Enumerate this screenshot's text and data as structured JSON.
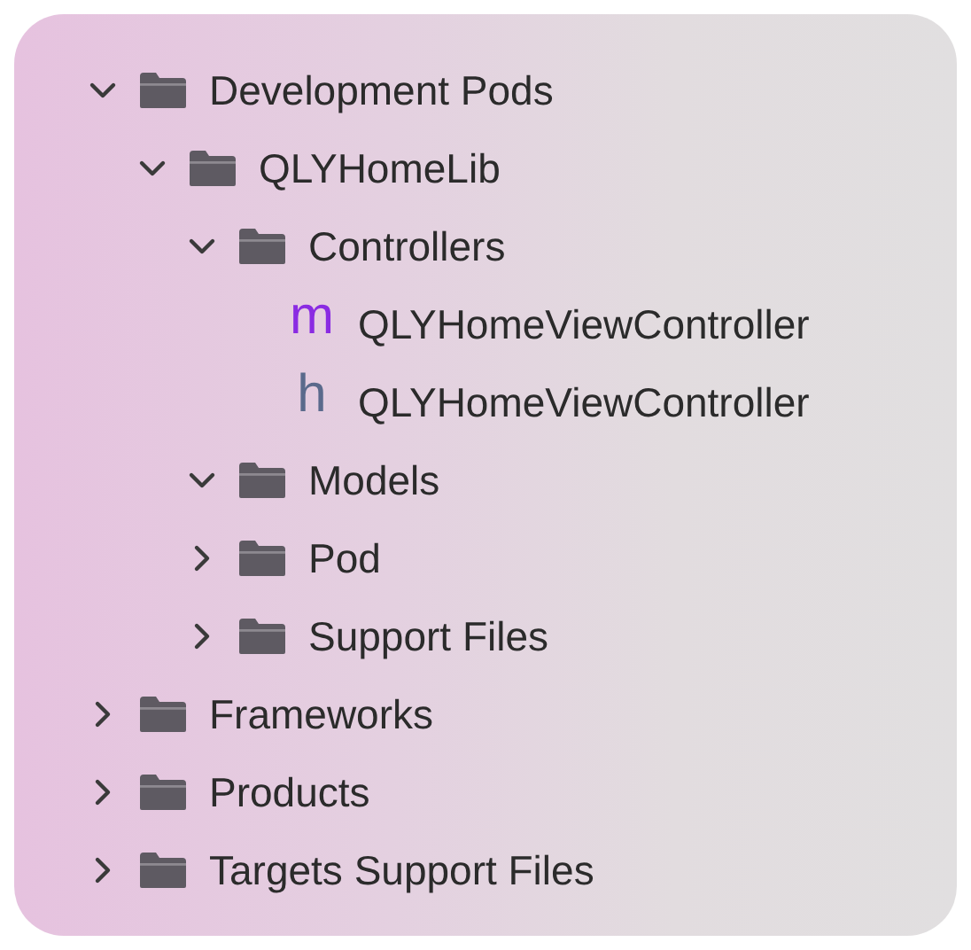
{
  "tree": [
    {
      "kind": "folder",
      "label": "Development Pods",
      "expanded": true,
      "children": [
        {
          "kind": "folder",
          "label": "QLYHomeLib",
          "expanded": true,
          "children": [
            {
              "kind": "folder",
              "label": "Controllers",
              "expanded": true,
              "children": [
                {
                  "kind": "file",
                  "badge": "m",
                  "color": "#8a2be2",
                  "label": "QLYHomeViewController"
                },
                {
                  "kind": "file",
                  "badge": "h",
                  "color": "#5a6a8c",
                  "label": "QLYHomeViewController"
                }
              ]
            },
            {
              "kind": "folder",
              "label": "Models",
              "expanded": true
            },
            {
              "kind": "folder",
              "label": "Pod",
              "expanded": false
            },
            {
              "kind": "folder",
              "label": "Support Files",
              "expanded": false
            }
          ]
        }
      ]
    },
    {
      "kind": "folder",
      "label": "Frameworks",
      "expanded": false
    },
    {
      "kind": "folder",
      "label": "Products",
      "expanded": false
    },
    {
      "kind": "folder",
      "label": "Targets Support Files",
      "expanded": false
    }
  ]
}
